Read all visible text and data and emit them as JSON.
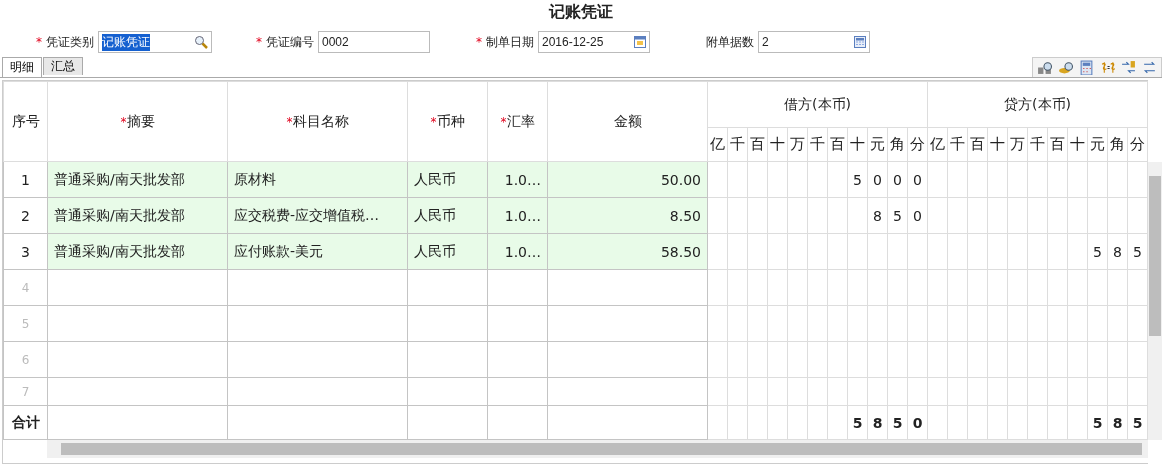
{
  "title": "记账凭证",
  "form": [
    {
      "kind": "lookup",
      "mark": "*",
      "label": "凭证类别",
      "value": "记账凭证",
      "highlighted": true
    },
    {
      "kind": "text",
      "mark": "*",
      "label": "凭证编号",
      "value": "0002",
      "highlighted": false
    },
    {
      "kind": "date",
      "mark": "*",
      "label": "制单日期",
      "value": "2016-12-25",
      "highlighted": false
    },
    {
      "kind": "number",
      "label": "附单据数",
      "value": "2",
      "highlighted": false
    }
  ],
  "tabs": [
    {
      "label": "明细",
      "selected": true
    },
    {
      "label": "汇总",
      "selected": false
    }
  ],
  "table": {
    "columns": [
      {
        "label": "序号"
      },
      {
        "label": "摘要",
        "mark": "*"
      },
      {
        "label": "科目名称",
        "mark": "*"
      },
      {
        "label": "币种",
        "mark": "*"
      },
      {
        "label": "汇率",
        "mark": "*"
      },
      {
        "label": "金额"
      }
    ],
    "groups": [
      {
        "label": "借方(本币)",
        "units": [
          "亿",
          "千",
          "百",
          "十",
          "万",
          "千",
          "百",
          "十",
          "元",
          "角",
          "分"
        ]
      },
      {
        "label": "贷方(本币)",
        "units": [
          "亿",
          "千",
          "百",
          "十",
          "万",
          "千",
          "百",
          "十",
          "元",
          "角",
          "分"
        ]
      }
    ],
    "rows": [
      {
        "index": "1",
        "summary": "普通采购/南天批发部",
        "account": "原材料",
        "currency": "人民币",
        "rate": "1.0…",
        "amount": "50.00",
        "debit": [
          "5",
          "0",
          "0",
          "0"
        ]
      },
      {
        "index": "2",
        "summary": "普通采购/南天批发部",
        "account": "应交税费-应交增值税…",
        "currency": "人民币",
        "rate": "1.0…",
        "amount": "8.50",
        "debit": [
          "8",
          "5",
          "0"
        ]
      },
      {
        "index": "3",
        "summary": "普通采购/南天批发部",
        "account": "应付账款-美元",
        "currency": "人民币",
        "rate": "1.0…",
        "amount": "58.50",
        "credit": [
          "5",
          "8",
          "5"
        ]
      }
    ],
    "blank_rows": [
      "4",
      "5",
      "6",
      "7"
    ],
    "total": {
      "label": "合计",
      "debit": [
        "5",
        "8",
        "5",
        "0"
      ],
      "credit": [
        "5",
        "8",
        "5"
      ]
    }
  }
}
